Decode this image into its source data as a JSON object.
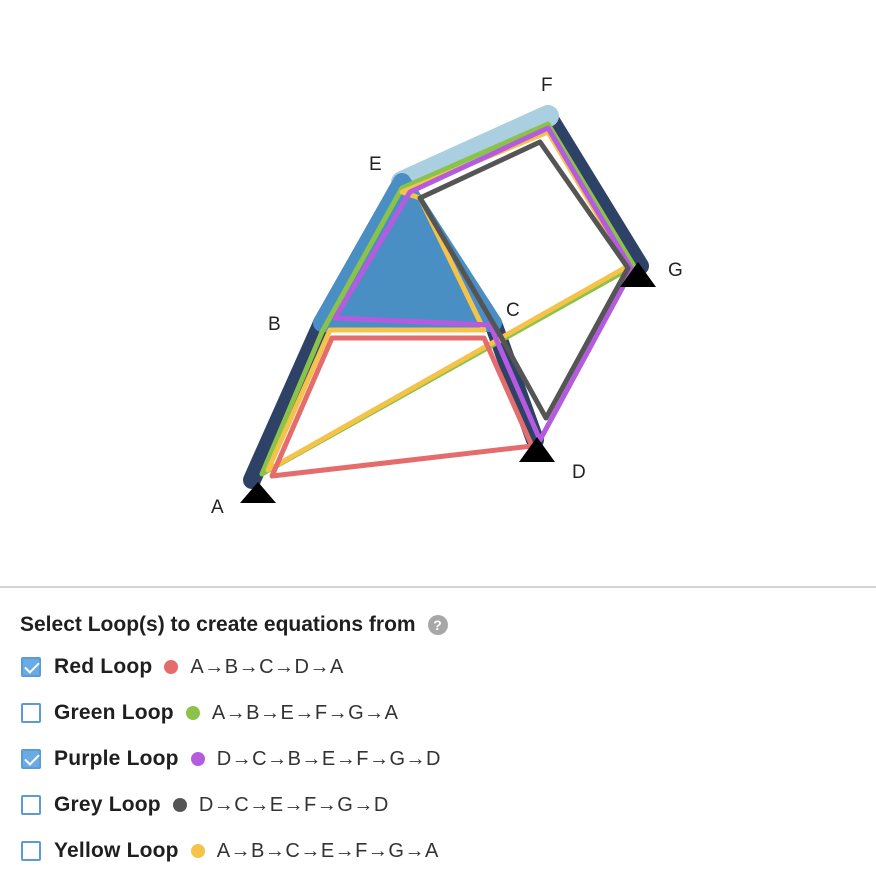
{
  "diagram": {
    "nodes": {
      "A": {
        "label": "A"
      },
      "B": {
        "label": "B"
      },
      "C": {
        "label": "C"
      },
      "D": {
        "label": "D"
      },
      "E": {
        "label": "E"
      },
      "F": {
        "label": "F"
      },
      "G": {
        "label": "G"
      }
    },
    "supports": [
      "A",
      "D",
      "G"
    ]
  },
  "panel": {
    "title": "Select Loop(s) to create equations from",
    "help_icon": "?"
  },
  "loops": [
    {
      "name": "Red Loop",
      "color": "#e46c6c",
      "path": "A→B→C→D→A",
      "checked": true
    },
    {
      "name": "Green Loop",
      "color": "#8bc34a",
      "path": "A→B→E→F→G→A",
      "checked": false
    },
    {
      "name": "Purple Loop",
      "color": "#b55be0",
      "path": "D→C→B→E→F→G→D",
      "checked": true
    },
    {
      "name": "Grey Loop",
      "color": "#555555",
      "path": "D→C→E→F→G→D",
      "checked": false
    },
    {
      "name": "Yellow Loop",
      "color": "#f5c24a",
      "path": "A→B→C→E→F→G→A",
      "checked": false
    }
  ],
  "colors": {
    "member_dark": "#2e4166",
    "member_blue": "#4a8fc4",
    "member_light": "#a9cfe0",
    "support": "#000000"
  }
}
